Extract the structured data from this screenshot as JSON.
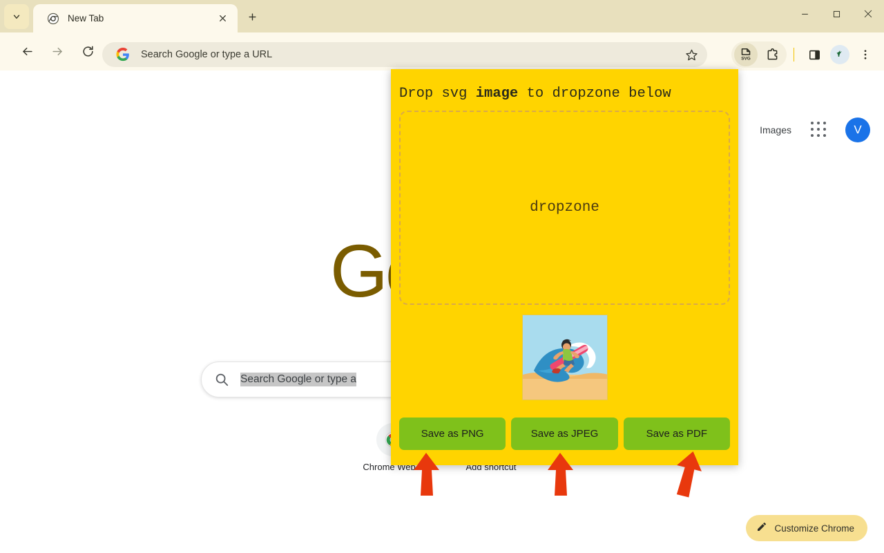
{
  "browser": {
    "tab_search_icon": "chevron-down-icon",
    "tab": {
      "favicon": "chrome-favicon",
      "title": "New Tab",
      "close_icon": "close-icon"
    },
    "new_tab_icon": "plus-icon",
    "window_controls": {
      "minimize": "minimize-icon",
      "maximize": "maximize-icon",
      "close": "close-icon"
    },
    "nav": {
      "back_icon": "arrow-left-icon",
      "forward_icon": "arrow-right-icon",
      "reload_icon": "reload-icon"
    },
    "omnibox": {
      "value": "",
      "placeholder": "Search Google or type a URL",
      "google_icon": "google-g-icon",
      "bookmark_icon": "star-icon"
    },
    "toolbar_icons": [
      {
        "name": "svg-extension-icon",
        "label": "SVG",
        "active": true
      },
      {
        "name": "extensions-puzzle-icon",
        "label": "",
        "active": false
      },
      {
        "name": "side-panel-icon",
        "label": "",
        "active": false
      },
      {
        "name": "profile-avatar-icon",
        "label": "",
        "active": false
      },
      {
        "name": "chrome-menu-icon",
        "label": "",
        "active": false
      }
    ]
  },
  "newtab": {
    "images_link": "Images",
    "apps_grid_icon": "apps-grid-icon",
    "avatar_initial": "V",
    "logo_text": "Google",
    "logo_color": "#7a5c00",
    "search": {
      "placeholder": "Search Google or type a",
      "search_icon": "search-icon"
    },
    "shortcuts": [
      {
        "label": "Chrome Web...",
        "icon": "chrome-webstore-icon"
      },
      {
        "label": "Add shortcut",
        "icon": "plus-icon"
      }
    ],
    "customize": {
      "label": "Customize Chrome",
      "icon": "pencil-icon"
    }
  },
  "popup": {
    "title_prefix": "Drop svg ",
    "title_bold": "image",
    "title_suffix": " to dropzone below",
    "dropzone_label": "dropzone",
    "background_color": "#ffd400",
    "button_color": "#7fc11b",
    "thumbnail": {
      "name": "surfer-illustration-thumbnail",
      "alt": "surfer riding a wave on a beach"
    },
    "buttons": [
      {
        "label": "Save as PNG",
        "name": "save-as-png-button"
      },
      {
        "label": "Save as JPEG",
        "name": "save-as-jpeg-button"
      },
      {
        "label": "Save as PDF",
        "name": "save-as-pdf-button"
      }
    ]
  },
  "annotations": {
    "arrow_color": "#e8380d",
    "arrows": [
      {
        "name": "annotation-arrow-png",
        "target": "Save as PNG"
      },
      {
        "name": "annotation-arrow-jpeg",
        "target": "Save as JPEG"
      },
      {
        "name": "annotation-arrow-pdf",
        "target": "Save as PDF"
      }
    ]
  }
}
